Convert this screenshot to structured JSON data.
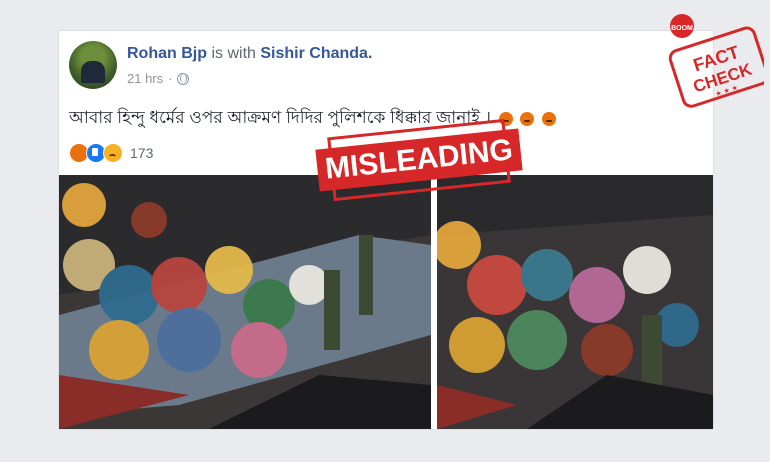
{
  "post": {
    "author": "Rohan Bjp",
    "with_text": "is with",
    "tagged": "Sishir Chanda.",
    "time": "21 hrs",
    "separator": "·",
    "text": "আবার হিন্দু ধর্মের ওপর আক্রমণ দিদির পুলিশকে ধিক্কার জানাই ।",
    "reaction_count": "173"
  },
  "stamp": {
    "label": "MISLEADING"
  },
  "logo": {
    "top": "BOOM",
    "line1": "FACT",
    "line2": "CHECK"
  },
  "colors": {
    "accent": "#d62828",
    "link": "#365899",
    "angry": "#e9710f"
  }
}
